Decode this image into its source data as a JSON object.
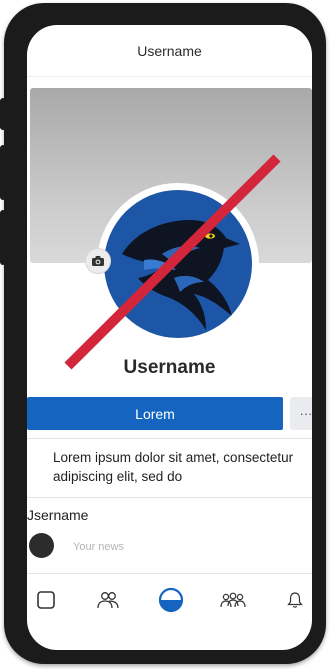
{
  "header": {
    "title": "Username"
  },
  "profile": {
    "name": "Username",
    "primary_button_label": "Lorem",
    "more_button_label": "···",
    "bio": "Lorem ipsum dolor sit amet, consectetur adipiscing elit, sed do"
  },
  "feed": {
    "author_name": "Jsername",
    "composer_placeholder": "Your news"
  },
  "icons": {
    "cover_camera": "camera-icon",
    "nav": [
      "home-square-icon",
      "friends-icon",
      "profile-circle-icon",
      "groups-icon",
      "bell-icon"
    ]
  },
  "colors": {
    "brand_blue": "#1565c0",
    "avatar_blue": "#1e56a7",
    "strike_red": "#d4263a",
    "nav_active": "#1565c0"
  }
}
